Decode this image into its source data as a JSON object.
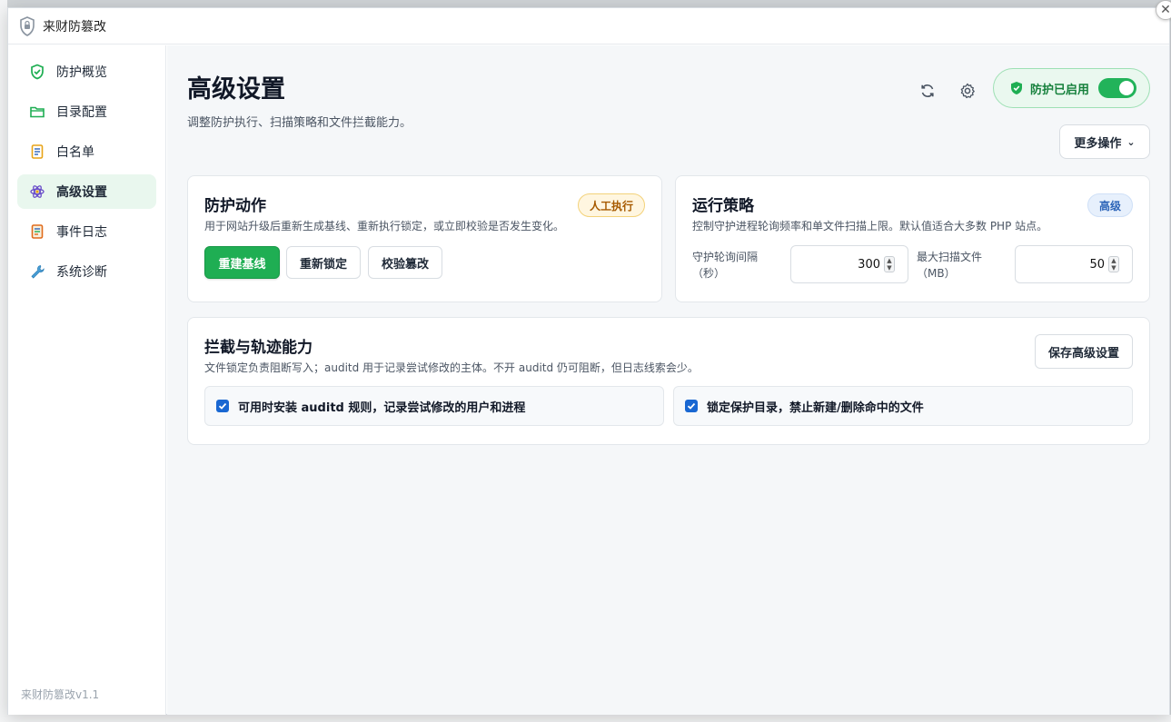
{
  "window": {
    "title": "来财防篡改"
  },
  "sidebar": {
    "items": [
      {
        "label": "防护概览",
        "icon": "shield-check-icon",
        "active": false
      },
      {
        "label": "目录配置",
        "icon": "folder-icon",
        "active": false
      },
      {
        "label": "白名单",
        "icon": "document-list-icon",
        "active": false
      },
      {
        "label": "高级设置",
        "icon": "atom-icon",
        "active": true
      },
      {
        "label": "事件日志",
        "icon": "log-icon",
        "active": false
      },
      {
        "label": "系统诊断",
        "icon": "wrench-icon",
        "active": false
      }
    ],
    "version": "来财防篡改v1.1"
  },
  "header": {
    "title": "高级设置",
    "subtitle": "调整防护执行、扫描策略和文件拦截能力。",
    "status_label": "防护已启用",
    "status_on": true,
    "more_label": "更多操作"
  },
  "actions_card": {
    "title": "防护动作",
    "desc": "用于网站升级后重新生成基线、重新执行锁定，或立即校验是否发生变化。",
    "badge": "人工执行",
    "buttons": [
      "重建基线",
      "重新锁定",
      "校验篡改"
    ]
  },
  "policy_card": {
    "title": "运行策略",
    "desc": "控制守护进程轮询频率和单文件扫描上限。默认值适合大多数 PHP 站点。",
    "badge": "高级",
    "poll_label_1": "守护轮询间隔",
    "poll_label_2": "（秒）",
    "poll_value": "300",
    "maxscan_label_1": "最大扫描文件",
    "maxscan_label_2": "（MB）",
    "maxscan_value": "50"
  },
  "intercept_card": {
    "title": "拦截与轨迹能力",
    "desc": "文件锁定负责阻断写入；auditd 用于记录尝试修改的主体。不开 auditd 仍可阻断，但日志线索会少。",
    "save_label": "保存高级设置",
    "options": [
      {
        "label": "可用时安装 auditd 规则，记录尝试修改的用户和进程",
        "checked": true
      },
      {
        "label": "锁定保护目录，禁止新建/删除命中的文件",
        "checked": true
      }
    ]
  },
  "colors": {
    "accent": "#1fae53",
    "active_bg": "#e9f7ee",
    "checkbox": "#1967d2"
  }
}
